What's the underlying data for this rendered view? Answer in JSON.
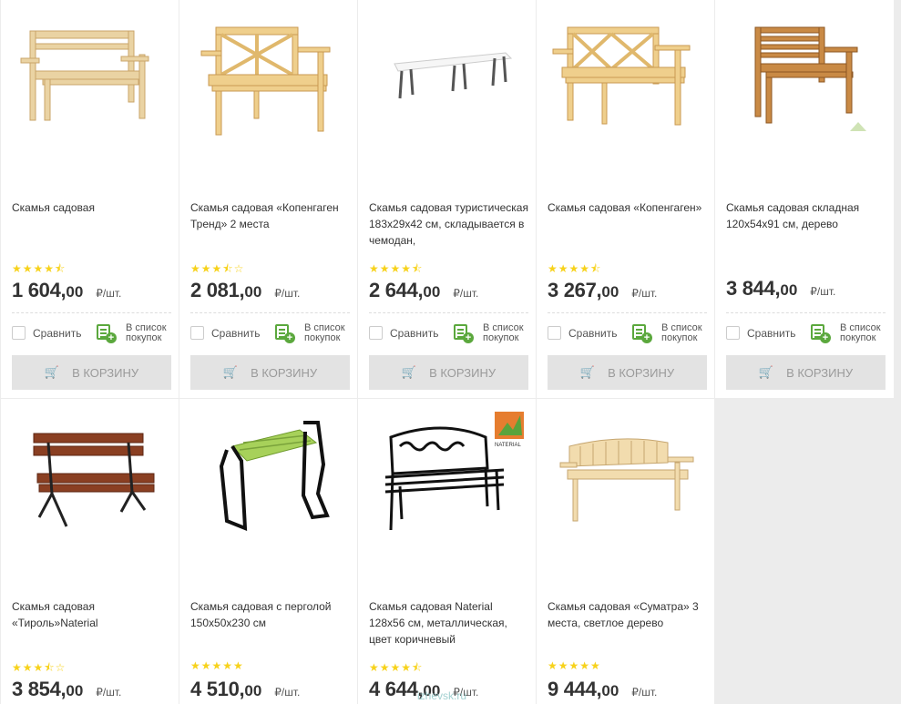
{
  "products": [
    {
      "title": "Скамья садовая",
      "rating": 4.5,
      "stars": "★★★★⯪",
      "price_main": "1 604,",
      "price_cents": "00",
      "unit": "₽/шт.",
      "compare": "Сравнить",
      "list_line1": "В список",
      "list_line2": "покупок",
      "cart": "В КОРЗИНУ"
    },
    {
      "title": "Скамья садовая «Копенгаген Тренд» 2 места",
      "rating": 3.5,
      "stars": "★★★⯪☆",
      "price_main": "2 081,",
      "price_cents": "00",
      "unit": "₽/шт.",
      "compare": "Сравнить",
      "list_line1": "В список",
      "list_line2": "покупок",
      "cart": "В КОРЗИНУ"
    },
    {
      "title": "Скамья садовая туристическая 183х29х42 см, складывается в чемодан,",
      "rating": 4.5,
      "stars": "★★★★⯪",
      "price_main": "2 644,",
      "price_cents": "00",
      "unit": "₽/шт.",
      "compare": "Сравнить",
      "list_line1": "В список",
      "list_line2": "покупок",
      "cart": "В КОРЗИНУ"
    },
    {
      "title": "Скамья садовая «Копенгаген»",
      "rating": 4.5,
      "stars": "★★★★⯪",
      "price_main": "3 267,",
      "price_cents": "00",
      "unit": "₽/шт.",
      "compare": "Сравнить",
      "list_line1": "В список",
      "list_line2": "покупок",
      "cart": "В КОРЗИНУ"
    },
    {
      "title": "Скамья садовая складная 120х54х91 см, дерево",
      "rating": null,
      "stars": "",
      "price_main": "3 844,",
      "price_cents": "00",
      "unit": "₽/шт.",
      "compare": "Сравнить",
      "list_line1": "В список",
      "list_line2": "покупок",
      "cart": "В КОРЗИНУ"
    },
    {
      "title": "Скамья садовая «Тироль»Naterial",
      "rating": 3.5,
      "stars": "★★★⯪☆",
      "price_main": "3 854,",
      "price_cents": "00",
      "unit": "₽/шт."
    },
    {
      "title": "Скамья садовая с перголой 150х50х230 см",
      "rating": 5,
      "stars": "★★★★★",
      "price_main": "4 510,",
      "price_cents": "00",
      "unit": "₽/шт."
    },
    {
      "title": "Скамья садовая Naterial 128х56 см, металлическая, цвет коричневый",
      "rating": 4.5,
      "stars": "★★★★⯪",
      "price_main": "4 644,",
      "price_cents": "00",
      "unit": "₽/шт."
    },
    {
      "title": "Скамья садовая «Суматра» 3 места, светлое дерево",
      "rating": 5,
      "stars": "★★★★★",
      "price_main": "9 444,",
      "price_cents": "00",
      "unit": "₽/шт."
    }
  ],
  "badges": {
    "naterial": "NATERIAL"
  },
  "watermark": "izhevsk.ru",
  "colors": {
    "star": "#f7d21b",
    "button_bg": "#e3e3e3",
    "list_icon": "#5ba83d",
    "wood_light": "#e9c98a",
    "wood_dark": "#b8772f"
  }
}
